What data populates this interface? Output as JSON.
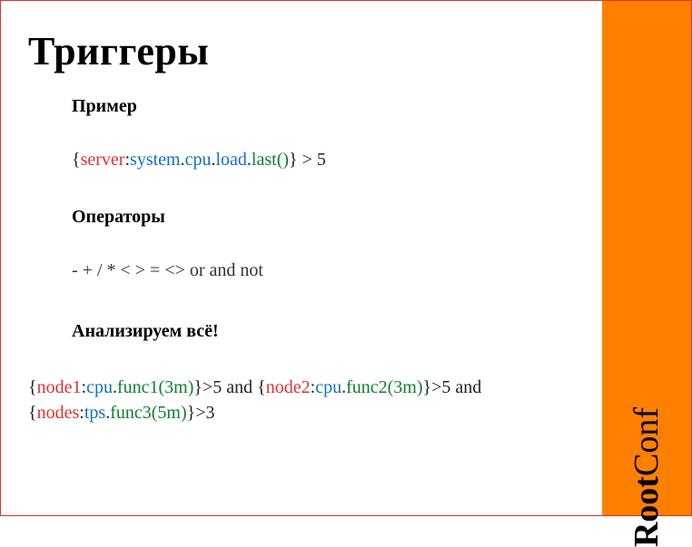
{
  "title": "Триггеры",
  "section_example": "Пример",
  "section_operators": "Операторы",
  "section_analyze": "Анализируем всё!",
  "example": {
    "brace_open": "{",
    "server": "server",
    "colon1": ":",
    "system": "system",
    "dot1": ".",
    "cpu": "cpu",
    "dot2": ".",
    "load": "load",
    "dot3": ".",
    "last": "last()",
    "brace_close": "}",
    "rest": " > 5"
  },
  "operators": "- + / *     < > = <>   or and not",
  "expr": {
    "p1_brace_open": "{",
    "p1_node": "node1",
    "p1_colon": ":",
    "p1_cpu": "cpu",
    "p1_dot": ".",
    "p1_func": "func1(3m)",
    "p1_brace_close": "}",
    "p1_rest": ">5 and ",
    "p2_brace_open": "{",
    "p2_node": "node2",
    "p2_colon": ":",
    "p2_cpu": "cpu",
    "p2_dot": ".",
    "p2_func": "func2(3m)",
    "p2_brace_close": "}",
    "p2_rest": ">5 and",
    "p3_brace_open": "{",
    "p3_node": "nodes",
    "p3_colon": ":",
    "p3_tps": "tps",
    "p3_dot": ".",
    "p3_func": "func3(5m)",
    "p3_brace_close": "}",
    "p3_rest": ">3"
  },
  "brand": {
    "root": "Root",
    "conf": "Conf"
  }
}
